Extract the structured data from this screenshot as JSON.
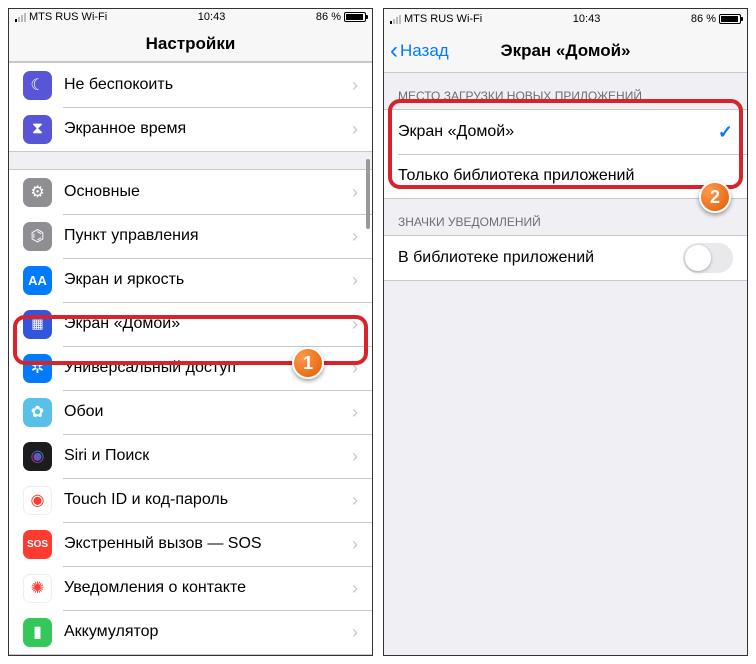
{
  "status": {
    "carrier": "MTS RUS Wi-Fi",
    "time": "10:43",
    "battery_pct": "86 %"
  },
  "left": {
    "title": "Настройки",
    "group1": [
      {
        "label": "Не беспокоить",
        "icon": "dnd"
      },
      {
        "label": "Экранное время",
        "icon": "screentime"
      }
    ],
    "group2": [
      {
        "label": "Основные",
        "icon": "general"
      },
      {
        "label": "Пункт управления",
        "icon": "control"
      },
      {
        "label": "Экран и яркость",
        "icon": "display"
      },
      {
        "label": "Экран «Домой»",
        "icon": "home"
      },
      {
        "label": "Универсальный доступ",
        "icon": "access"
      },
      {
        "label": "Обои",
        "icon": "wallpaper"
      },
      {
        "label": "Siri и Поиск",
        "icon": "siri"
      },
      {
        "label": "Touch ID и код-пароль",
        "icon": "touchid"
      },
      {
        "label": "Экстренный вызов — SOS",
        "icon": "sos"
      },
      {
        "label": "Уведомления о контакте",
        "icon": "notif"
      },
      {
        "label": "Аккумулятор",
        "icon": "battery"
      }
    ]
  },
  "right": {
    "back": "Назад",
    "title": "Экран «Домой»",
    "section1_header": "МЕСТО ЗАГРУЗКИ НОВЫХ ПРИЛОЖЕНИЙ",
    "options": [
      {
        "label": "Экран «Домой»",
        "selected": true
      },
      {
        "label": "Только библиотека приложений",
        "selected": false
      }
    ],
    "section2_header": "ЗНАЧКИ УВЕДОМЛЕНИЙ",
    "toggle_label": "В библиотеке приложений"
  },
  "annotations": {
    "badge1": "1",
    "badge2": "2"
  }
}
